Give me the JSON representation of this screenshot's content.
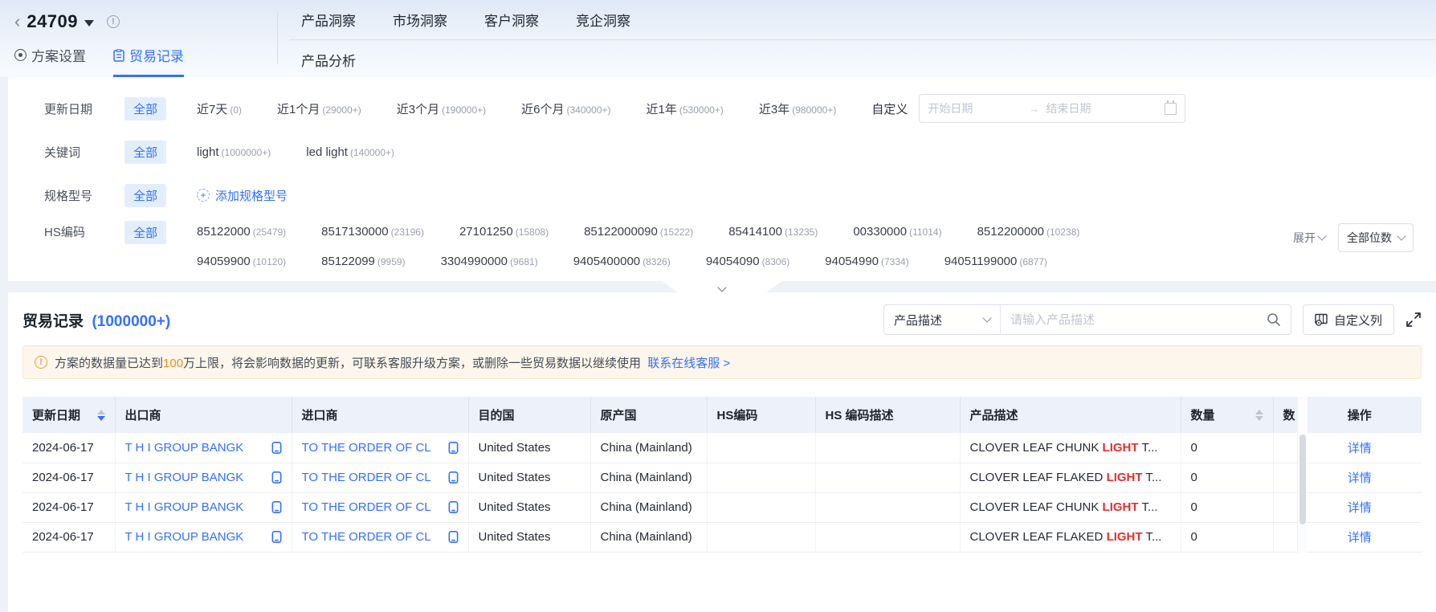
{
  "header": {
    "plan_id": "24709",
    "nav_items": [
      "产品洞察",
      "市场洞察",
      "客户洞察",
      "竞企洞察"
    ],
    "sub_nav_item": "产品分析",
    "tab_settings": "方案设置",
    "tab_records": "贸易记录"
  },
  "filters": {
    "all_label": "全部",
    "update_date": {
      "label": "更新日期",
      "options": [
        {
          "text": "近7天",
          "count": "(0)"
        },
        {
          "text": "近1个月",
          "count": "(29000+)"
        },
        {
          "text": "近3个月",
          "count": "(190000+)"
        },
        {
          "text": "近6个月",
          "count": "(340000+)"
        },
        {
          "text": "近1年",
          "count": "(530000+)"
        },
        {
          "text": "近3年",
          "count": "(980000+)"
        }
      ],
      "custom_label": "自定义",
      "start_placeholder": "开始日期",
      "end_placeholder": "结束日期"
    },
    "keyword": {
      "label": "关键词",
      "options": [
        {
          "text": "light",
          "count": "(1000000+)"
        },
        {
          "text": "led light",
          "count": "(140000+)"
        }
      ]
    },
    "spec": {
      "label": "规格型号",
      "add_label": "添加规格型号"
    },
    "hs_code": {
      "label": "HS编码",
      "line1": [
        {
          "text": "85122000",
          "count": "(25479)"
        },
        {
          "text": "8517130000",
          "count": "(23196)"
        },
        {
          "text": "27101250",
          "count": "(15808)"
        },
        {
          "text": "85122000090",
          "count": "(15222)"
        },
        {
          "text": "85414100",
          "count": "(13235)"
        },
        {
          "text": "00330000",
          "count": "(11014)"
        },
        {
          "text": "8512200000",
          "count": "(10238)"
        }
      ],
      "line2": [
        {
          "text": "94059900",
          "count": "(10120)"
        },
        {
          "text": "85122099",
          "count": "(9959)"
        },
        {
          "text": "3304990000",
          "count": "(9681)"
        },
        {
          "text": "9405400000",
          "count": "(8326)"
        },
        {
          "text": "94054090",
          "count": "(8306)"
        },
        {
          "text": "94054990",
          "count": "(7334)"
        },
        {
          "text": "94051199000",
          "count": "(6877)"
        }
      ],
      "expand_label": "展开",
      "digits_label": "全部位数"
    }
  },
  "records": {
    "title": "贸易记录",
    "count": "(1000000+)",
    "search_type": "产品描述",
    "search_placeholder": "请输入产品描述",
    "custom_columns_label": "自定义列",
    "warning": {
      "text_before": "方案的数据量已达到",
      "highlight": "100",
      "text_after": "万上限，将会影响数据的更新，可联系客服升级方案，或删除一些贸易数据以继续使用",
      "link": "联系在线客服 >"
    },
    "table": {
      "headers": {
        "date": "更新日期",
        "exporter": "出口商",
        "importer": "进口商",
        "destination": "目的国",
        "origin": "原产国",
        "hs_code": "HS编码",
        "hs_desc": "HS 编码描述",
        "product": "产品描述",
        "quantity": "数量",
        "qty_unit": "数",
        "action": "操作"
      },
      "rows": [
        {
          "date": "2024-06-17",
          "exporter": "T H I GROUP BANGK",
          "importer": "TO THE ORDER OF CL",
          "destination": "United States",
          "origin": "China (Mainland)",
          "product_before": "CLOVER LEAF CHUNK ",
          "product_highlight": "LIGHT",
          "product_after": " T...",
          "quantity": "0",
          "action": "详情"
        },
        {
          "date": "2024-06-17",
          "exporter": "T H I GROUP BANGK",
          "importer": "TO THE ORDER OF CL",
          "destination": "United States",
          "origin": "China (Mainland)",
          "product_before": "CLOVER LEAF FLAKED ",
          "product_highlight": "LIGHT",
          "product_after": " T...",
          "quantity": "0",
          "action": "详情"
        },
        {
          "date": "2024-06-17",
          "exporter": "T H I GROUP BANGK",
          "importer": "TO THE ORDER OF CL",
          "destination": "United States",
          "origin": "China (Mainland)",
          "product_before": "CLOVER LEAF CHUNK ",
          "product_highlight": "LIGHT",
          "product_after": " T...",
          "quantity": "0",
          "action": "详情"
        },
        {
          "date": "2024-06-17",
          "exporter": "T H I GROUP BANGK",
          "importer": "TO THE ORDER OF CL",
          "destination": "United States",
          "origin": "China (Mainland)",
          "product_before": "CLOVER LEAF FLAKED ",
          "product_highlight": "LIGHT",
          "product_after": " T...",
          "quantity": "0",
          "action": "详情"
        }
      ]
    }
  },
  "colors": {
    "primary": "#3370ff",
    "highlight_red": "#e62e2e",
    "warning_orange": "#f08c1f",
    "selected_chip_bg": "#e3eefc"
  }
}
